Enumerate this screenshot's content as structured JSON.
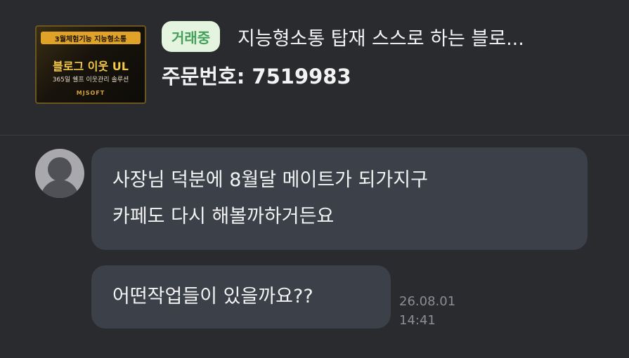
{
  "header": {
    "thumbnail": {
      "top_label": "3월체험기능 지능형소통",
      "title": "블로그 이웃 UL",
      "subtitle": "365일 쉘프 이웃관리 솔루션",
      "brand": "MJSOFT"
    },
    "status_badge": "거래중",
    "product_title": "지능형소통 탑재 스스로 하는 블로...",
    "order_number": "주문번호: 7519983"
  },
  "messages": [
    {
      "lines": [
        "사장님 덕분에 8월달 메이트가 되가지구",
        "카페도 다시 해볼까하거든요"
      ]
    },
    {
      "lines": [
        "어떤작업들이 있을까요??"
      ],
      "date": "26.08.01",
      "time": "14:41"
    }
  ],
  "colors": {
    "background": "#2a2b2f",
    "bubble": "#3b4049",
    "badge_bg": "#e4f4df",
    "badge_text": "#43a15a",
    "meta_text": "#8a8d93"
  }
}
